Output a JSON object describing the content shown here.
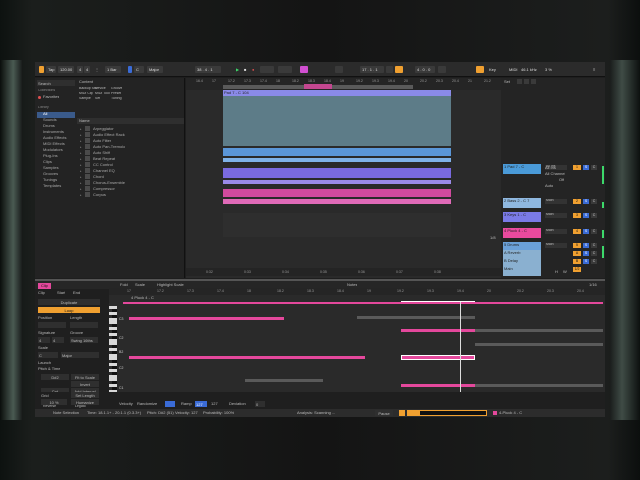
{
  "transport": {
    "tap": "Tap",
    "tempo": "120.00",
    "time_sig_num": "4",
    "time_sig_den": "4",
    "quantize": "1 Bar",
    "key": "C",
    "scale": "Major",
    "position": "38 . 4 . 1",
    "loop_start": "17 . 1 . 1",
    "loop_length": "4 . 0 . 0",
    "key_label": "Key",
    "midi_label": "MIDI",
    "cpu": "46.1 kHz",
    "percent": "3 %"
  },
  "browser": {
    "search_placeholder": "Search",
    "collections_header": "Collections",
    "favorites": "Favorites",
    "library_header": "Library",
    "library_items": [
      "All",
      "Sounds",
      "Drums",
      "Instruments",
      "Audio Effects",
      "MIDI Effects",
      "Modulators",
      "Plug-Ins",
      "Clips",
      "Samples",
      "Grooves",
      "Tunings",
      "Templates"
    ],
    "content_label": "Content",
    "tags": [
      "Backup Set",
      "Device",
      "Groove",
      "MIDI Clip",
      "MIDI Tool",
      "Preset",
      "Sample",
      "Set",
      "Tuning"
    ],
    "name_header": "Name",
    "files": [
      "Arpeggiator",
      "Audio Effect Rack",
      "Auto Filter",
      "Auto Pan-Tremolo",
      "Auto Shift",
      "Beat Repeat",
      "CC Control",
      "Channel EQ",
      "Chord",
      "Chorus-Ensemble",
      "Compressor",
      "Corpus"
    ]
  },
  "arrangement": {
    "ruler": [
      "16.4",
      "17",
      "17.2",
      "17.3",
      "17.4",
      "18",
      "18.2",
      "18.3",
      "18.4",
      "19",
      "19.2",
      "19.3",
      "19.4",
      "20",
      "20.2",
      "20.3",
      "20.4",
      "21",
      "21.2"
    ],
    "time_ruler": [
      "0:32",
      "0:33",
      "0:34",
      "0:35",
      "0:36",
      "0:37",
      "0:38"
    ],
    "clip_name": "Pad 7 - C 104",
    "page_indicator": "1/8"
  },
  "mixer": {
    "set_label": "Set",
    "all_ins": "All Ins",
    "input_channel": "All Channel",
    "monitor": "Auto",
    "off": "Off",
    "tracks": [
      {
        "name": "1 Pad 7 - C",
        "color": "#4a9ad8",
        "route": "All Ins",
        "num": "1",
        "s": "S",
        "c": "C"
      },
      {
        "name": "2 Bass 2 - C 7",
        "color": "#8fb8e0",
        "route": "Main",
        "num": "2",
        "s": "S",
        "c": "C"
      },
      {
        "name": "3 Keys 1 - C",
        "color": "#7a7ae6",
        "route": "Main",
        "num": "3",
        "s": "S",
        "c": "C"
      },
      {
        "name": "4 Pluck 4 - C",
        "color": "#e94a9e",
        "route": "Main",
        "num": "4",
        "s": "S",
        "c": "C"
      },
      {
        "name": "5 Drums",
        "color": "#6aa0d8",
        "route": "Main",
        "num": "5",
        "s": "S",
        "c": "C"
      },
      {
        "name": "A Reverb",
        "color": "#8ab0d0",
        "route": "",
        "num": "A",
        "s": "S",
        "c": "C"
      },
      {
        "name": "B Delay",
        "color": "#8ab0d0",
        "route": "",
        "num": "B",
        "s": "S",
        "c": "C"
      },
      {
        "name": "Main",
        "color": "#8ab0d0",
        "route": "",
        "num": "1/2",
        "s": "",
        "c": ""
      }
    ],
    "h": "H",
    "w": "W"
  },
  "clip": {
    "tabs": [
      "Clip",
      "Fold",
      "Scale",
      "Highlight Scale"
    ],
    "notes_tab": "Notes",
    "clip_label": "Clip",
    "duplicate": "Duplicate",
    "loop": "Loop",
    "position_label": "Position",
    "length_label": "Length",
    "signature_label": "Signature",
    "groove_label": "Groove",
    "sig_num": "4",
    "sig_den": "4",
    "groove_value": "Swing 16ths",
    "scale_label": "Scale",
    "scale_key": "C",
    "scale_mode": "Major",
    "launch_label": "Launch",
    "pitch_time_label": "Pitch & Time",
    "root_note": "D#2",
    "fit_to_scale": "Fit to Scale",
    "invert": "Invert",
    "crd": "Crd",
    "add_interval": "Add Interval",
    "stretch_label": "Stretch",
    "stretch_value": "x2",
    "ratio": "x1.0",
    "div": "/2",
    "grid_label": "Grid",
    "set_length": "Set Length",
    "grid_value": "10 %",
    "humanize": "Humanize",
    "reverse": "Reverse",
    "legato": "Legato",
    "transform": "Transform",
    "start_label": "Start",
    "end_label": "End",
    "clip_title": "4 Pluck 4 - C",
    "page_indicator": "1/16",
    "ruler": [
      "17",
      "17.2",
      "17.3",
      "17.4",
      "18",
      "18.2",
      "18.3",
      "18.4",
      "19",
      "19.2",
      "19.3",
      "19.4",
      "20",
      "20.2",
      "20.3",
      "20.4"
    ],
    "pitches": [
      "C3",
      "C2",
      "B2",
      "C2",
      "C1"
    ],
    "velocity_label": "Velocity",
    "randomize": "Randomize",
    "ramp_label": "Ramp",
    "ramp_value": "127",
    "vel_end": "127",
    "deviation_label": "Deviation",
    "deviation_value": "0",
    "chance_label": "Chance"
  },
  "status": {
    "mode": "Note Selection",
    "time": "Time: 18.1.1+ - 20.1.1 (0.3.3+)",
    "pitch": "Pitch: D#2 (51)",
    "velocity": "Velocity: 127",
    "probability": "Probability: 100%",
    "analysis": "Analysis: Scanning ...",
    "pause": "Pause",
    "track_sel": "4-Pluck 4 - C",
    "progress": 0.15
  }
}
